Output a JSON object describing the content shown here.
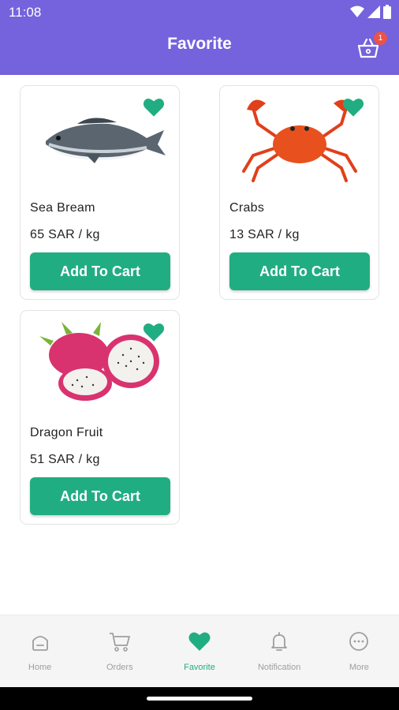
{
  "status_bar": {
    "time": "11:08"
  },
  "header": {
    "title": "Favorite",
    "cart_badge": "1"
  },
  "colors": {
    "header_bg": "#7562dd",
    "accent": "#21ad82",
    "badge": "#e8534a"
  },
  "products": [
    {
      "name": "Sea Bream",
      "price": "65 SAR / kg",
      "button": "Add To Cart",
      "image_icon": "fish-image"
    },
    {
      "name": "Crabs",
      "price": "13 SAR / kg",
      "button": "Add To Cart",
      "image_icon": "crab-image"
    },
    {
      "name": "Dragon Fruit",
      "price": "51 SAR / kg",
      "button": "Add To Cart",
      "image_icon": "dragon-fruit-image"
    }
  ],
  "nav": {
    "items": [
      {
        "label": "Home",
        "icon": "home-icon"
      },
      {
        "label": "Orders",
        "icon": "cart-icon"
      },
      {
        "label": "Favorite",
        "icon": "heart-icon",
        "active": true
      },
      {
        "label": "Notification",
        "icon": "bell-icon"
      },
      {
        "label": "More",
        "icon": "more-icon"
      }
    ]
  }
}
